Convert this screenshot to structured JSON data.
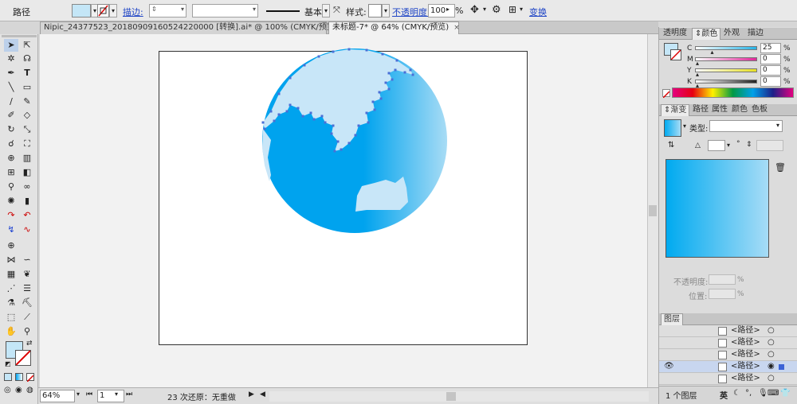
{
  "control_bar": {
    "object_type": "路径",
    "stroke_label": "描边:",
    "stroke_profile": "基本",
    "style_label": "样式:",
    "opacity_label": "不透明度:",
    "opacity_value": "100",
    "opacity_unit": "%",
    "transform_label": "变换"
  },
  "tabs": [
    {
      "label": "Nipic_24377523_20180909160524220000 [转换].ai* @ 100% (CMYK/预览)",
      "active": false
    },
    {
      "label": "未标题-7* @ 64% (CMYK/预览)",
      "active": true
    }
  ],
  "tab_close_glyph": "×",
  "color_panel": {
    "tabs": [
      "透明度",
      "颜色",
      "外观",
      "描边"
    ],
    "active_tab": "颜色",
    "channels": [
      {
        "label": "C",
        "value": "25",
        "unit": "%",
        "color": "#27b3e6"
      },
      {
        "label": "M",
        "value": "0",
        "unit": "%",
        "color": "#e0279a"
      },
      {
        "label": "Y",
        "value": "0",
        "unit": "%",
        "color": "#e6e024"
      },
      {
        "label": "K",
        "value": "0",
        "unit": "%",
        "color": "#222222"
      }
    ]
  },
  "gradient_panel": {
    "tabs": [
      "渐变",
      "路径",
      "属性",
      "颜色",
      "色板"
    ],
    "active_tab": "渐变",
    "type_label": "类型:",
    "angle_unit": "°",
    "opacity_label": "不透明度:",
    "opacity_unit": "%",
    "position_label": "位置:",
    "position_unit": "%",
    "gradient_start": "#00aaf0",
    "gradient_end": "#a7dcf6"
  },
  "layers_panel": {
    "title": "图层",
    "rows": [
      {
        "name": "<路径>",
        "selected": false
      },
      {
        "name": "<路径>",
        "selected": false
      },
      {
        "name": "<路径>",
        "selected": false
      },
      {
        "name": "<路径>",
        "selected": true
      },
      {
        "name": "<路径>",
        "selected": false
      }
    ],
    "count_label": "1 个图层"
  },
  "status_bar": {
    "zoom": "64%",
    "artboard": "1",
    "undo_text": "23 次还原：无重做"
  },
  "ime": {
    "label": "英"
  },
  "fill_color": "#c4e6f7",
  "globe": {
    "ocean_dark": "#00a3ee",
    "ocean_light": "#a8dcf5",
    "land_color": "#c8e6f8",
    "anchor_color": "#4a6fd6"
  }
}
